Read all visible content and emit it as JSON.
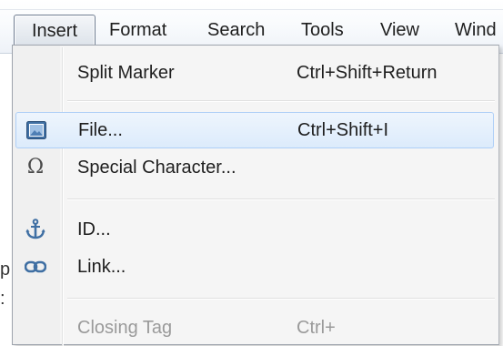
{
  "menubar": {
    "items": [
      {
        "label": "Insert",
        "open": true
      },
      {
        "label": "Format"
      },
      {
        "label": "Search"
      },
      {
        "label": "Tools"
      },
      {
        "label": "View"
      },
      {
        "label": "Wind"
      }
    ]
  },
  "background_text": [
    "p",
    ":"
  ],
  "dropdown": {
    "items": [
      {
        "label": "Split Marker",
        "shortcut": "Ctrl+Shift+Return",
        "icon": null
      },
      {
        "label": "File...",
        "shortcut": "Ctrl+Shift+I",
        "icon": "image-file-icon",
        "highlighted": true
      },
      {
        "label": "Special Character...",
        "shortcut": "",
        "icon": "omega-icon"
      },
      {
        "label": "ID...",
        "shortcut": "",
        "icon": "anchor-icon"
      },
      {
        "label": "Link...",
        "shortcut": "",
        "icon": "link-icon"
      },
      {
        "label": "Closing Tag",
        "shortcut": "Ctrl+",
        "icon": null,
        "disabled": true
      }
    ]
  },
  "colors": {
    "highlight_border": "#aecff7",
    "highlight_fill": "#dcebfb",
    "icon_blue": "#3f6fa3"
  }
}
